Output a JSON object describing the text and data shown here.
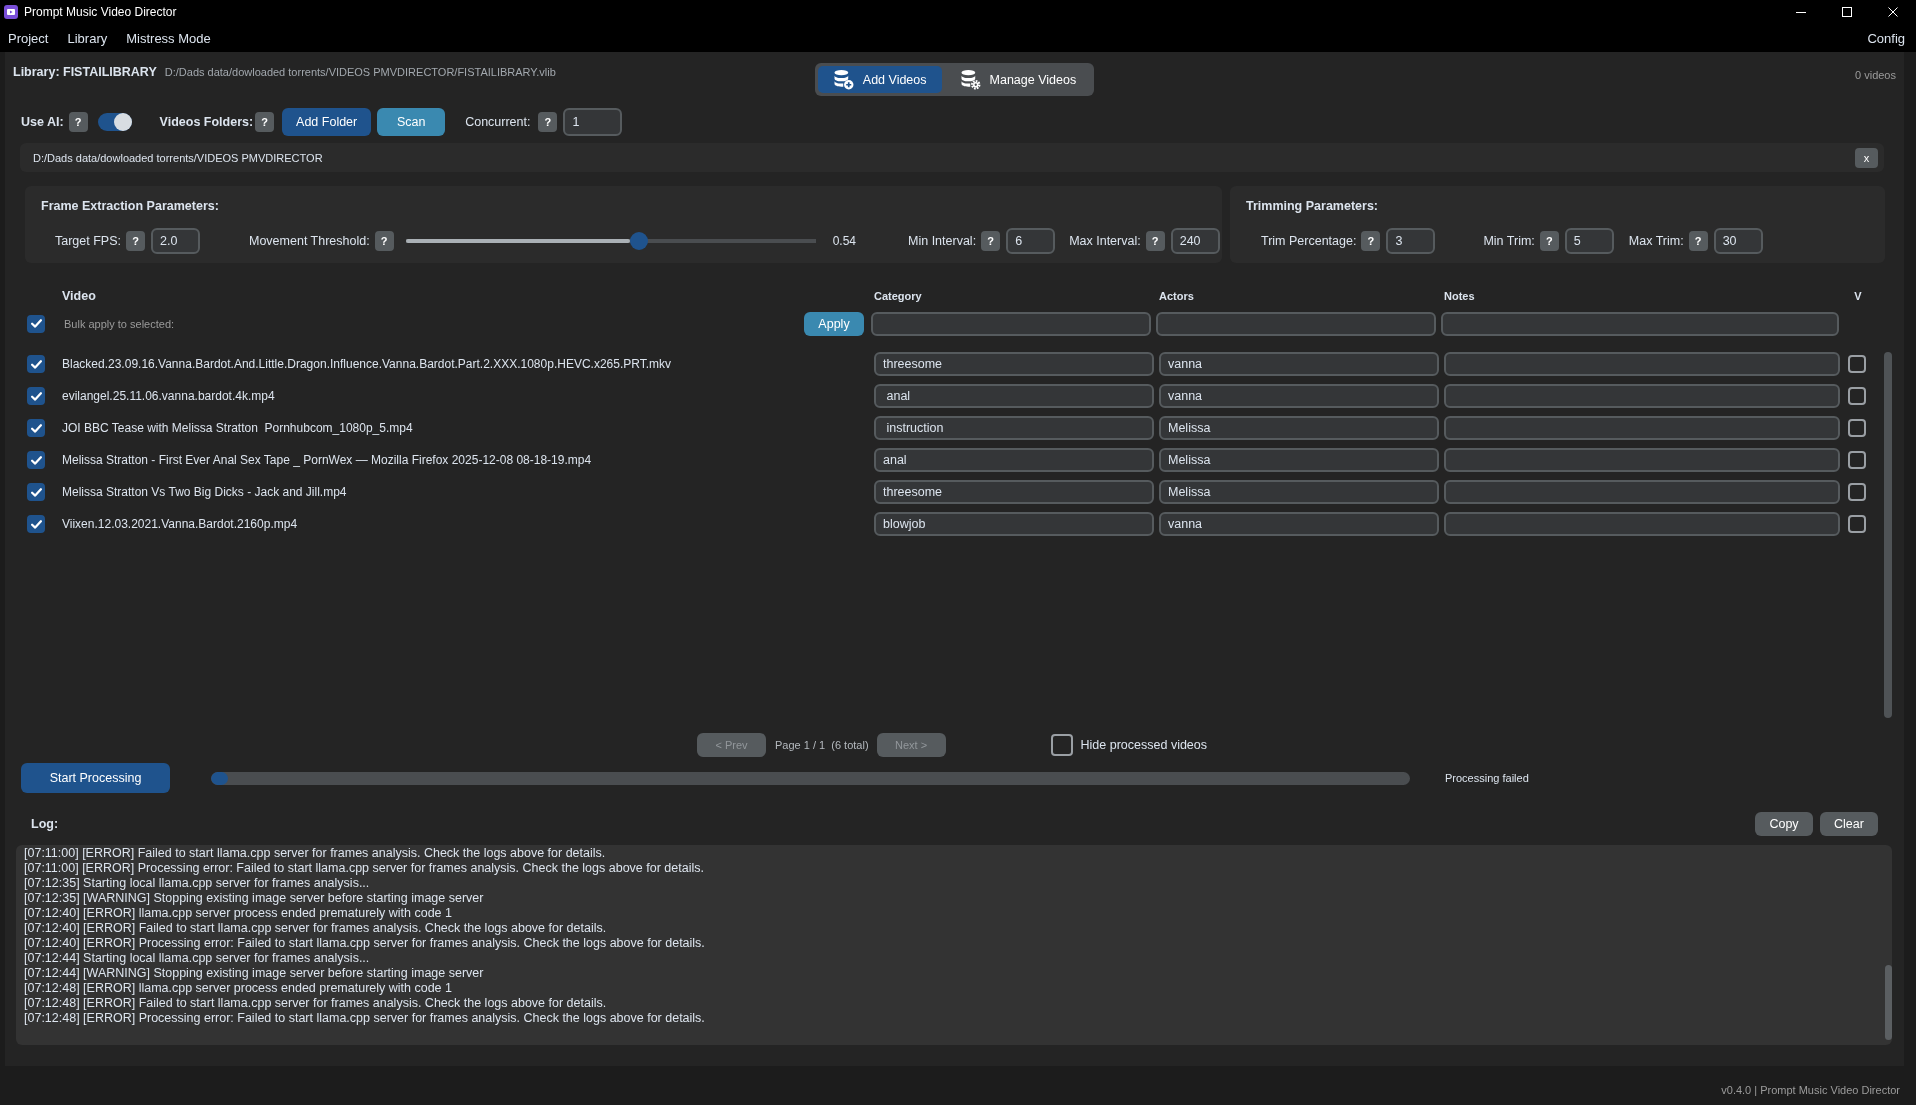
{
  "window": {
    "title": "Prompt Music Video Director"
  },
  "menu_bar": {
    "items": [
      "Project",
      "Library",
      "Mistress Mode"
    ],
    "config": "Config"
  },
  "library": {
    "title": "Library: FISTAILIBRARY",
    "path": "D:/Dads data/dowloaded torrents/VIDEOS PMVDIRECTOR/FISTAILIBRARY.vlib",
    "count": "0 videos"
  },
  "view_tabs": [
    {
      "label": "Add Videos",
      "selected": true,
      "kind": "add"
    },
    {
      "label": "Manage Videos",
      "selected": false,
      "kind": "manage"
    }
  ],
  "options": {
    "use_ai": {
      "label": "Use AI:",
      "help": "?",
      "on": true
    },
    "folders": {
      "label": "Videos Folders:",
      "help": "?",
      "buttons": [
        {
          "label": "Add Folder",
          "kind": "primary"
        },
        {
          "label": "Scan",
          "kind": "accent"
        }
      ]
    },
    "concurrent": {
      "label": "Concurrent:",
      "help": "?",
      "value": "1"
    }
  },
  "folders": [
    {
      "path": "D:/Dads data/dowloaded torrents/VIDEOS PMVDIRECTOR",
      "remove": "x"
    }
  ],
  "frame_extraction": {
    "title": "Frame Extraction Parameters:",
    "fields": [
      {
        "kind": "entry",
        "label": "Target FPS:",
        "help": "?",
        "value": "2.0"
      },
      {
        "kind": "slider",
        "label": "Movement Threshold:",
        "help": "?",
        "level": 0.57,
        "reading": "0.54"
      },
      {
        "kind": "entry",
        "label": "Min Interval:",
        "help": "?",
        "value": "6"
      },
      {
        "kind": "entry",
        "label": "Max Interval:",
        "help": "?",
        "value": "240"
      }
    ]
  },
  "trimming": {
    "title": "Trimming Parameters:",
    "fields": [
      {
        "kind": "entry",
        "label": "Trim Percentage:",
        "help": "?",
        "value": "3"
      },
      {
        "kind": "entry",
        "label": "Min Trim:",
        "help": "?",
        "value": "5"
      },
      {
        "kind": "entry",
        "label": "Max Trim:",
        "help": "?",
        "value": "30"
      }
    ]
  },
  "table": {
    "columns": [
      "Video",
      "Category",
      "Actors",
      "Notes",
      "V"
    ],
    "bulk": {
      "checked": true,
      "label": "Bulk apply to selected:",
      "button": "Apply"
    },
    "rows": [
      {
        "checked": true,
        "video": "Blacked.23.09.16.Vanna.Bardot.And.Little.Dragon.Influence.Vanna.Bardot.Part.2.XXX.1080p.HEVC.x265.PRT.mkv",
        "category": "threesome",
        "actors": "vanna",
        "v_checked": false
      },
      {
        "checked": true,
        "video": "evilangel.25.11.06.vanna.bardot.4k.mp4",
        "category": " anal",
        "actors": "vanna",
        "v_checked": false
      },
      {
        "checked": true,
        "video": "JOI BBC Tease with Melissa Stratton  Pornhubcom_1080p_5.mp4",
        "category": " instruction",
        "actors": "Melissa",
        "v_checked": false
      },
      {
        "checked": true,
        "video": "Melissa Stratton - First Ever Anal Sex Tape _ PornWex — Mozilla Firefox 2025-12-08 08-18-19.mp4",
        "category": "anal",
        "actors": "Melissa",
        "v_checked": false
      },
      {
        "checked": true,
        "video": "Melissa Stratton Vs Two Big Dicks - Jack and Jill.mp4",
        "category": "threesome",
        "actors": "Melissa",
        "v_checked": false
      },
      {
        "checked": true,
        "video": "Viixen.12.03.2021.Vanna.Bardot.2160p.mp4",
        "category": "blowjob",
        "actors": "vanna",
        "v_checked": false
      }
    ]
  },
  "pagination": {
    "prev": {
      "label": "< Prev",
      "disabled": true
    },
    "info": "Page 1 / 1  (6 total)",
    "next": {
      "label": "Next >",
      "disabled": true
    },
    "hide_processed": {
      "label": "Hide processed videos",
      "checked": false
    }
  },
  "processing": {
    "button": "Start Processing",
    "level": 0.014,
    "status": "Processing failed"
  },
  "log": {
    "label": "Log:",
    "buttons": [
      "Copy",
      "Clear"
    ],
    "lines": [
      "[07:11:00] [ERROR] Failed to start llama.cpp server for frames analysis. Check the logs above for details.",
      "[07:11:00] [ERROR] Processing error: Failed to start llama.cpp server for frames analysis. Check the logs above for details.",
      "[07:12:35] Starting local llama.cpp server for frames analysis...",
      "[07:12:35] [WARNING] Stopping existing image server before starting image server",
      "[07:12:40] [ERROR] llama.cpp server process ended prematurely with code 1",
      "[07:12:40] [ERROR] Failed to start llama.cpp server for frames analysis. Check the logs above for details.",
      "[07:12:40] [ERROR] Processing error: Failed to start llama.cpp server for frames analysis. Check the logs above for details.",
      "[07:12:44] Starting local llama.cpp server for frames analysis...",
      "[07:12:44] [WARNING] Stopping existing image server before starting image server",
      "[07:12:48] [ERROR] llama.cpp server process ended prematurely with code 1",
      "[07:12:48] [ERROR] Failed to start llama.cpp server for frames analysis. Check the logs above for details.",
      "[07:12:48] [ERROR] Processing error: Failed to start llama.cpp server for frames analysis. Check the logs above for details."
    ]
  },
  "status_bar": {
    "version": "v0.4.0 | Prompt Music Video Director"
  }
}
